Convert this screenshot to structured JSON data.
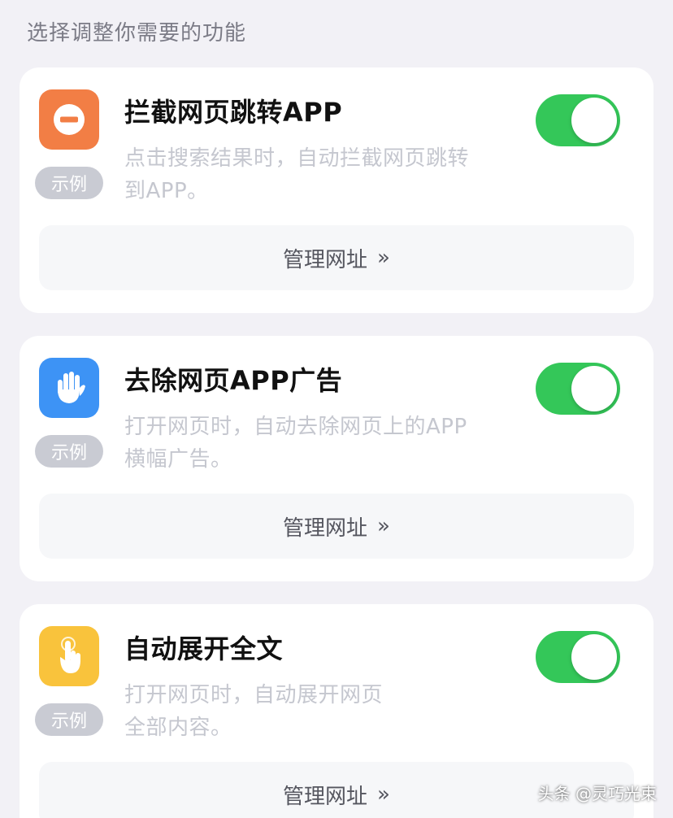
{
  "section_title": "选择调整你需要的功能",
  "features": [
    {
      "icon": "stop-icon",
      "icon_color": "#f27e45",
      "example_label": "示例",
      "title": "拦截网页跳转APP",
      "desc_line1": "点击搜索结果时，自动拦截网页跳转",
      "desc_line2": "到APP。",
      "enabled": true,
      "manage_label": "管理网址",
      "manage_chevron": "»"
    },
    {
      "icon": "hand-icon",
      "icon_color": "#3d93f5",
      "example_label": "示例",
      "title": "去除网页APP广告",
      "desc_line1": "打开网页时，自动去除网页上的APP",
      "desc_line2": "横幅广告。",
      "enabled": true,
      "manage_label": "管理网址",
      "manage_chevron": "»"
    },
    {
      "icon": "pointer-hand-icon",
      "icon_color": "#f9c33c",
      "example_label": "示例",
      "title": "自动展开全文",
      "desc_line1": "打开网页时，自动展开网页",
      "desc_line2": "全部内容。",
      "enabled": true,
      "manage_label": "管理网址",
      "manage_chevron": "»"
    }
  ],
  "toggle_on_color": "#34c759",
  "watermark": "头条 @灵巧光束"
}
